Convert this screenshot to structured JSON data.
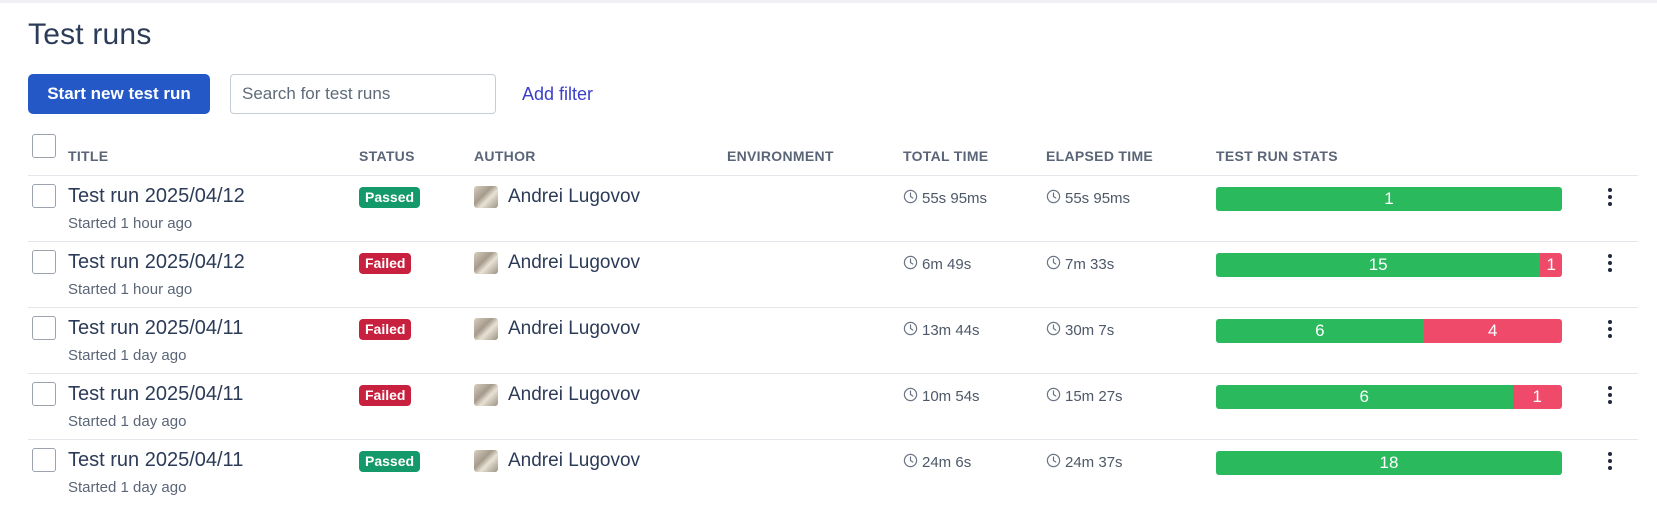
{
  "page": {
    "title": "Test runs"
  },
  "toolbar": {
    "start_label": "Start new test run",
    "search_placeholder": "Search for test runs",
    "search_value": "",
    "add_filter_label": "Add filter"
  },
  "table": {
    "headers": {
      "title": "TITLE",
      "status": "STATUS",
      "author": "AUTHOR",
      "environment": "ENVIRONMENT",
      "total_time": "TOTAL TIME",
      "elapsed_time": "ELAPSED TIME",
      "stats": "TEST RUN STATS"
    },
    "rows": [
      {
        "title": "Test run 2025/04/12",
        "started": "Started 1 hour ago",
        "status": "Passed",
        "author": "Andrei Lugovov",
        "environment": "",
        "total_time": "55s 95ms",
        "elapsed_time": "55s 95ms",
        "passed": 1,
        "failed": 0
      },
      {
        "title": "Test run 2025/04/12",
        "started": "Started 1 hour ago",
        "status": "Failed",
        "author": "Andrei Lugovov",
        "environment": "",
        "total_time": "6m 49s",
        "elapsed_time": "7m 33s",
        "passed": 15,
        "failed": 1
      },
      {
        "title": "Test run 2025/04/11",
        "started": "Started 1 day ago",
        "status": "Failed",
        "author": "Andrei Lugovov",
        "environment": "",
        "total_time": "13m 44s",
        "elapsed_time": "30m 7s",
        "passed": 6,
        "failed": 4
      },
      {
        "title": "Test run 2025/04/11",
        "started": "Started 1 day ago",
        "status": "Failed",
        "author": "Andrei Lugovov",
        "environment": "",
        "total_time": "10m 54s",
        "elapsed_time": "15m 27s",
        "passed": 6,
        "failed": 1
      },
      {
        "title": "Test run 2025/04/11",
        "started": "Started 1 day ago",
        "status": "Passed",
        "author": "Andrei Lugovov",
        "environment": "",
        "total_time": "24m 6s",
        "elapsed_time": "24m 37s",
        "passed": 18,
        "failed": 0
      }
    ]
  },
  "icons": {
    "time": "clock-icon",
    "menu": "more-vertical-icon"
  },
  "colors": {
    "primary": "#2458c6",
    "passed_badge": "#14996a",
    "failed_badge": "#c8203f",
    "pass_bar": "#2bb95e",
    "fail_bar": "#ef4a6a",
    "link": "#3a3ec8"
  }
}
